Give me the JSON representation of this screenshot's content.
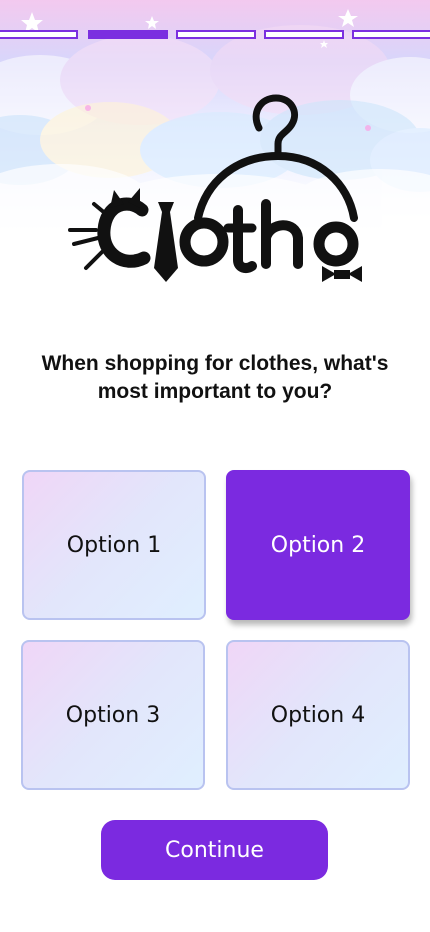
{
  "theme": {
    "accent": "#7b2ae0",
    "option_border": "#b9c3f0"
  },
  "progress": {
    "total_steps": 5,
    "current_step": 2
  },
  "logo": {
    "text": "Clotho"
  },
  "question": {
    "text": "When shopping for clothes, what's\nmost important to you?"
  },
  "options": [
    {
      "label": "Option 1",
      "selected": false
    },
    {
      "label": "Option 2",
      "selected": true
    },
    {
      "label": "Option 3",
      "selected": false
    },
    {
      "label": "Option 4",
      "selected": false
    }
  ],
  "continue_button": {
    "label": "Continue"
  }
}
